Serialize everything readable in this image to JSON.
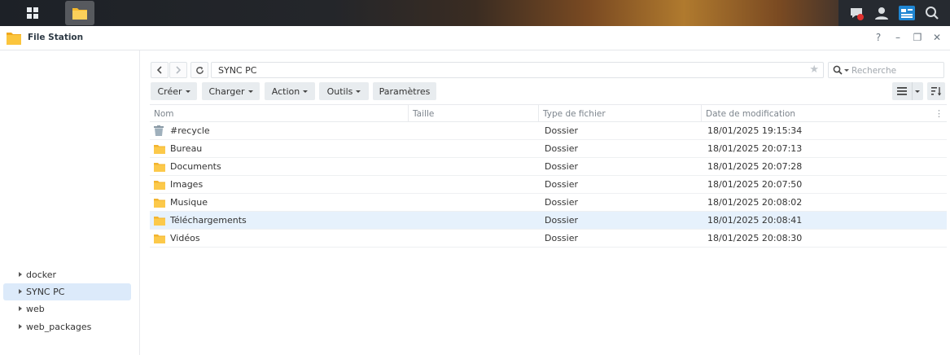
{
  "colors": {
    "accent": "#1f86d3",
    "folder": "#f6c244",
    "selected_row": "#e6f1fc",
    "selected_tree": "#dceafa"
  },
  "taskbar": {
    "icons": [
      "main-menu-icon",
      "file-station-icon",
      "chat-notification-icon",
      "user-icon",
      "widgets-icon",
      "search-icon"
    ]
  },
  "window": {
    "title": "File Station",
    "controls": {
      "help": "?",
      "minimize": "–",
      "restore": "❐",
      "close": "✕"
    }
  },
  "sidebar": {
    "items": [
      {
        "label": "docker",
        "selected": false
      },
      {
        "label": "SYNC PC",
        "selected": true
      },
      {
        "label": "web",
        "selected": false
      },
      {
        "label": "web_packages",
        "selected": false
      }
    ]
  },
  "nav": {
    "path": "SYNC PC",
    "search_placeholder": "Recherche"
  },
  "toolbar": {
    "create": "Créer",
    "upload": "Charger",
    "action": "Action",
    "tools": "Outils",
    "settings": "Paramètres"
  },
  "table": {
    "columns": [
      "Nom",
      "Taille",
      "Type de fichier",
      "Date de modification"
    ],
    "rows": [
      {
        "name": "#recycle",
        "type": "Dossier",
        "date": "18/01/2025 19:15:34",
        "icon": "trash-icon"
      },
      {
        "name": "Bureau",
        "type": "Dossier",
        "date": "18/01/2025 20:07:13",
        "icon": "folder-icon"
      },
      {
        "name": "Documents",
        "type": "Dossier",
        "date": "18/01/2025 20:07:28",
        "icon": "folder-icon"
      },
      {
        "name": "Images",
        "type": "Dossier",
        "date": "18/01/2025 20:07:50",
        "icon": "folder-icon"
      },
      {
        "name": "Musique",
        "type": "Dossier",
        "date": "18/01/2025 20:08:02",
        "icon": "folder-icon"
      },
      {
        "name": "Téléchargements",
        "type": "Dossier",
        "date": "18/01/2025 20:08:41",
        "icon": "folder-icon",
        "highlighted": true
      },
      {
        "name": "Vidéos",
        "type": "Dossier",
        "date": "18/01/2025 20:08:30",
        "icon": "folder-icon"
      }
    ]
  }
}
